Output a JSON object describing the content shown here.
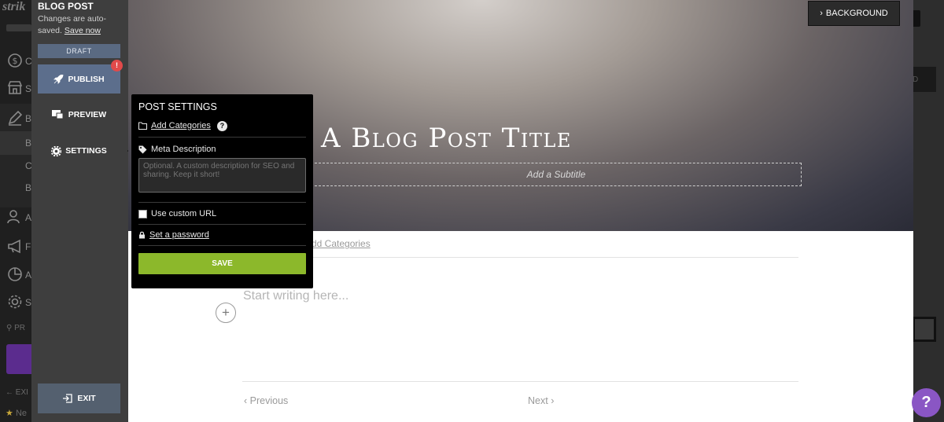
{
  "background_app": {
    "logo_text": "strik",
    "nav_letters": [
      "C",
      "S",
      "B",
      "B",
      "C",
      "B",
      "A",
      "F",
      "A",
      "S"
    ],
    "search_label": "PR",
    "exit_label": "EXI",
    "star_label": "Ne",
    "right_btn_label": "D"
  },
  "editor_panel": {
    "title": "BLOG POST",
    "autosave_text": "Changes are auto-saved.",
    "save_now_label": "Save now",
    "status_badge": "DRAFT",
    "publish_label": "PUBLISH",
    "publish_alert": "!",
    "preview_label": "PREVIEW",
    "settings_label": "SETTINGS",
    "exit_label": "EXIT"
  },
  "canvas": {
    "background_button": "BACKGROUND",
    "post_title": "A Blog Post Title",
    "subtitle_placeholder": "Add a Subtitle",
    "categories_link": "dd Categories",
    "body_placeholder": "Start writing here...",
    "add_block_symbol": "+",
    "previous_label": "Previous",
    "next_label": "Next"
  },
  "post_settings": {
    "heading": "POST SETTINGS",
    "add_categories_label": "Add Categories",
    "help_symbol": "?",
    "meta_description_label": "Meta Description",
    "meta_description_placeholder": "Optional. A custom description for SEO and sharing. Keep it short!",
    "custom_url_label": "Use custom URL",
    "custom_url_checked": false,
    "password_label": "Set a password",
    "save_label": "SAVE"
  },
  "help_button": "?",
  "colors": {
    "save_green": "#8cb82b",
    "publish_blue": "#5c6e8c",
    "alert_red": "#e24a4a",
    "help_purple": "#8a56c4"
  }
}
